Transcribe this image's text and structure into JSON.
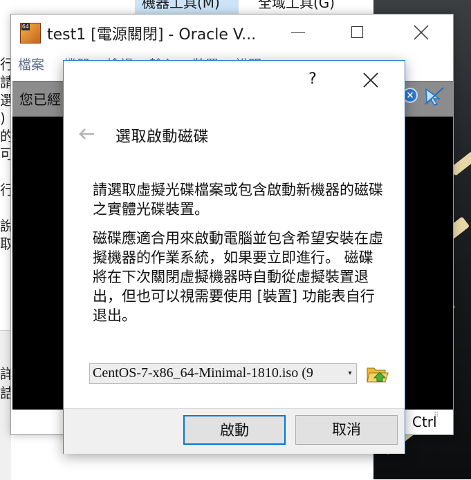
{
  "background": {
    "menubar": {
      "item1": "機器工具(M)",
      "item2": "全域工具(G)"
    },
    "side_glyphs": [
      "行",
      "請",
      "選",
      ")",
      "的",
      "可",
      "",
      "行",
      "",
      "說",
      "取"
    ],
    "lower_glyphs": [
      "詳",
      "詰"
    ]
  },
  "vbox_window": {
    "title": "test1 [電源關閉] - Oracle V...",
    "menu": [
      "檔案",
      "機器",
      "檢視",
      "輸入",
      "裝置",
      "說明"
    ],
    "notice_text": "您已經",
    "host_key": "Ctrl"
  },
  "dialog": {
    "help_label": "?",
    "heading": "選取啟動磁碟",
    "paragraph1": "請選取虛擬光碟檔案或包含啟動新機器的磁碟之實體光碟裝置。",
    "paragraph2": "磁碟應適合用來啟動電腦並包含希望安裝在虛擬機器的作業系統，如果要立即進行。 磁碟將在下次關閉虛擬機器時自動從虛擬裝置退出，但也可以視需要使用 [裝置] 功能表自行退出。",
    "disk_select": {
      "value": "CentOS-7-x86_64-Minimal-1810.iso (9"
    },
    "buttons": {
      "start": "啟動",
      "cancel": "取消"
    }
  },
  "colors": {
    "accent": "#0078d7",
    "dialog_border": "#2e7ec7",
    "notice_bg": "#8c8c8c",
    "vm_screen": "#000000"
  },
  "icons": [
    "vbox-app-icon",
    "minimize-icon",
    "maximize-icon",
    "close-icon",
    "help-icon",
    "back-arrow-icon",
    "dropdown-arrow-icon",
    "folder-open-icon",
    "notice-close-icon",
    "mouse-integration-icon"
  ]
}
